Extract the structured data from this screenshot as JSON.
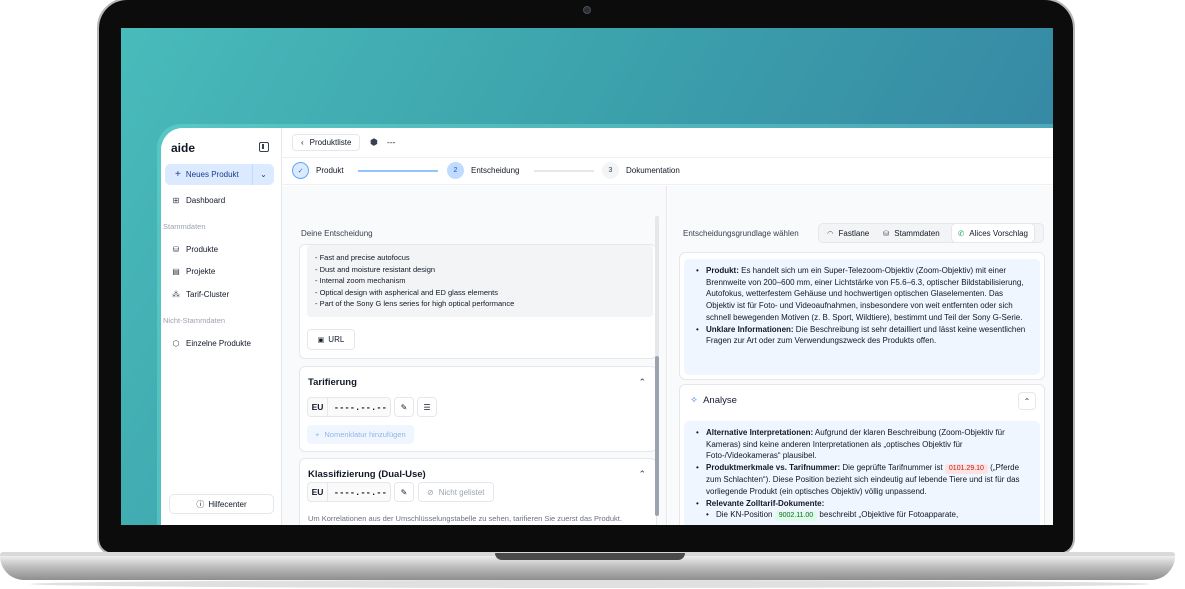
{
  "app": {
    "logo": "aide",
    "new_product_label": "Neues Produkt",
    "sidebar": {
      "main_items": [
        {
          "label": "Dashboard",
          "icon": "grid-icon"
        }
      ],
      "section_stammdaten": "Stammdaten",
      "stammdaten_items": [
        {
          "label": "Produkte",
          "icon": "database-icon"
        },
        {
          "label": "Projekte",
          "icon": "clipboard-icon"
        },
        {
          "label": "Tarif-Cluster",
          "icon": "cluster-icon"
        }
      ],
      "section_nicht_stammdaten": "Nicht-Stammdaten",
      "nicht_stammdaten_items": [
        {
          "label": "Einzelne Produkte",
          "icon": "box-icon"
        }
      ],
      "help_label": "Hilfecenter"
    },
    "topbar": {
      "back_label": "Produktliste",
      "current_product": "---"
    },
    "stepper": {
      "steps": [
        {
          "number": "1",
          "label": "Produkt",
          "state": "done"
        },
        {
          "number": "2",
          "label": "Entscheidung",
          "state": "active"
        },
        {
          "number": "3",
          "label": "Dokumentation",
          "state": "todo"
        }
      ]
    },
    "left": {
      "title": "Deine Entscheidung",
      "description_lines": [
        "- Fast and precise autofocus",
        "- Dust and moisture resistant design",
        "- Internal zoom mechanism",
        "- Optical design with aspherical and ED glass elements",
        "- Part of the Sony G lens series for high optical performance"
      ],
      "url_label": "URL",
      "tarifierung": {
        "title": "Tarifierung",
        "region": "EU",
        "code": "----.--.--",
        "add_label": "Nomenklatur hinzufügen"
      },
      "klassifizierung": {
        "title": "Klassifizierung (Dual-Use)",
        "region": "EU",
        "code": "----.--.--",
        "not_listed_label": "Nicht gelistet",
        "note": "Um Korrelationen aus der Umschlüsselungstabelle zu sehen, tarifieren Sie zuerst das Produkt."
      }
    },
    "right": {
      "label": "Entscheidungsgrundlage wählen",
      "tabs": [
        {
          "label": "Fastlane",
          "icon": "gauge-icon"
        },
        {
          "label": "Stammdaten",
          "icon": "database-icon"
        },
        {
          "label": "Alices Vorschlag",
          "icon": "chat-icon",
          "active": true
        }
      ],
      "summary": [
        {
          "bold": "Produkt:",
          "text": " Es handelt sich um ein Super-Telezoom-Objektiv (Zoom-Objektiv) mit einer Brennweite von 200–600 mm, einer Lichtstärke von F5.6–6.3, optischer Bildstabilisierung, Autofokus, wetterfestem Gehäuse und hochwertigen optischen Glaselementen. Das Objektiv ist für Foto- und Videoaufnahmen, insbesondere von weit entfernten oder sich schnell bewegenden Motiven (z. B. Sport, Wildtiere), bestimmt und Teil der Sony G-Serie."
        },
        {
          "bold": "Unklare Informationen:",
          "text": " Die Beschreibung ist sehr detailliert und lässt keine wesentlichen Fragen zur Art oder zum Verwendungszweck des Produkts offen."
        }
      ],
      "analyse": {
        "title": "Analyse",
        "items": [
          {
            "bold": "Alternative Interpretationen:",
            "text": " Aufgrund der klaren Beschreibung (Zoom-Objektiv für Kameras) sind keine anderen Interpretationen als „optisches Objektiv für Foto-/Videokameras“ plausibel."
          },
          {
            "bold": "Produktmerkmale vs. Tarifnummer:",
            "pre": " Die geprüfte Tarifnummer ist ",
            "badge": "0101.29.10",
            "post": " („Pferde zum Schlachten“). Diese Position bezieht sich eindeutig auf lebende Tiere und ist für das vorliegende Produkt (ein optisches Objektiv) völlig unpassend."
          },
          {
            "bold": "Relevante Zolltarif-Dokumente:",
            "text": ""
          },
          {
            "sub": true,
            "pre": "Die KN-Position ",
            "badge": "9002.11.00",
            "post": " beschreibt „Objektive für Fotoapparate,"
          }
        ]
      }
    }
  }
}
